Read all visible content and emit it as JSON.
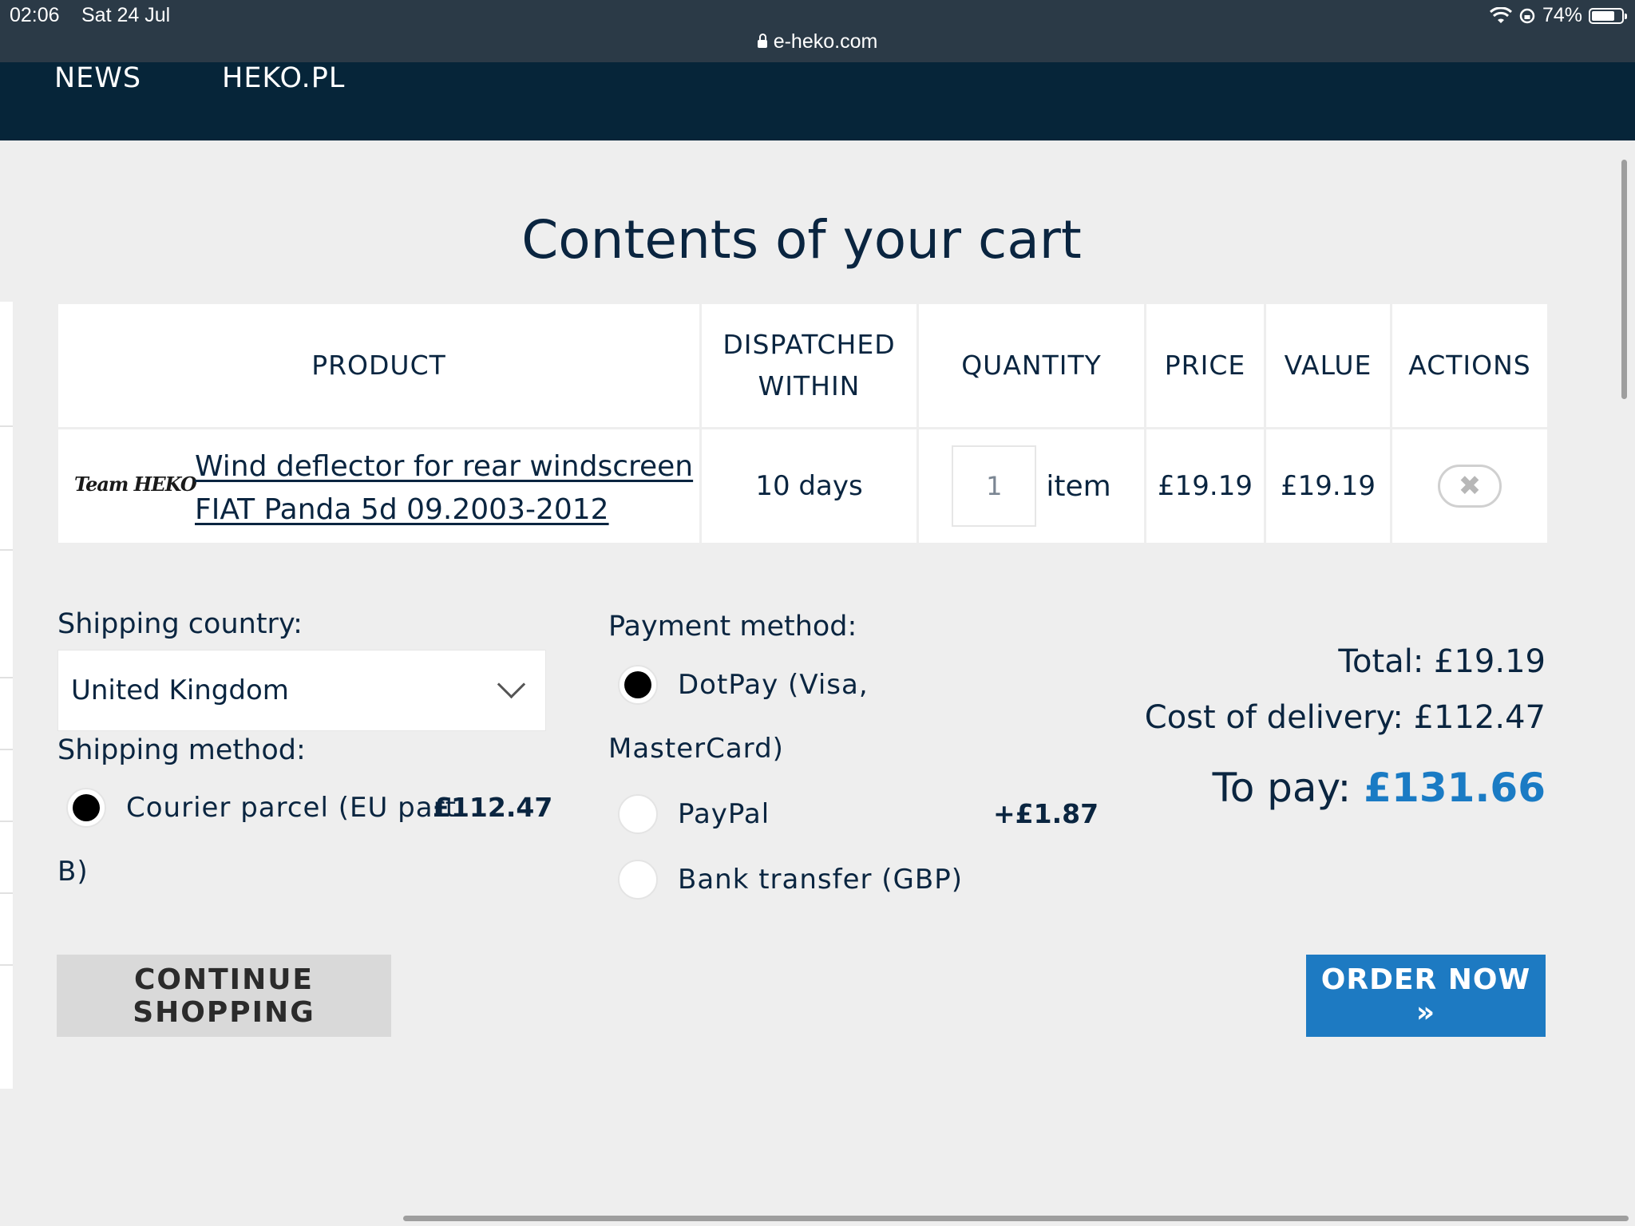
{
  "status_bar": {
    "time": "02:06",
    "date": "Sat 24 Jul",
    "battery": "74%",
    "url": "e-heko.com"
  },
  "nav": {
    "items": [
      "NEWS",
      "HEKO.PL"
    ]
  },
  "page_title": "Contents of your cart",
  "cart": {
    "headers": {
      "product": "PRODUCT",
      "dispatched_line1": "DISPATCHED",
      "dispatched_line2": "WITHIN",
      "quantity": "QUANTITY",
      "price": "PRICE",
      "value": "VALUE",
      "actions": "ACTIONS"
    },
    "rows": [
      {
        "brand": "Team HEKO",
        "product_line1": "Wind deflector for rear windscreen",
        "product_line2": "FIAT Panda 5d 09.2003-2012",
        "dispatched": "10 days",
        "quantity": "1",
        "unit": "item",
        "price": "£19.19",
        "value": "£19.19",
        "remove_icon": "close-x-icon"
      }
    ]
  },
  "shipping": {
    "country_label": "Shipping country:",
    "country_value": "United Kingdom",
    "method_label": "Shipping method:",
    "method_line1": "Courier parcel (EU part",
    "method_line2": "B)",
    "method_price": "£112.47"
  },
  "payment": {
    "label": "Payment method:",
    "option1_line1": "DotPay (Visa,",
    "option1_line2": "MasterCard)",
    "option2": "PayPal",
    "option2_fee": "+£1.87",
    "option3": "Bank transfer (GBP)"
  },
  "totals": {
    "total": "Total: £19.19",
    "delivery": "Cost of delivery: £112.47",
    "to_pay_label": "To pay: ",
    "to_pay_amount": "£131.66"
  },
  "buttons": {
    "continue": "CONTINUE SHOPPING",
    "order": "ORDER NOW »"
  },
  "colors": {
    "nav_bg": "#062539",
    "accent": "#1d7ac2",
    "text": "#0a2540"
  }
}
